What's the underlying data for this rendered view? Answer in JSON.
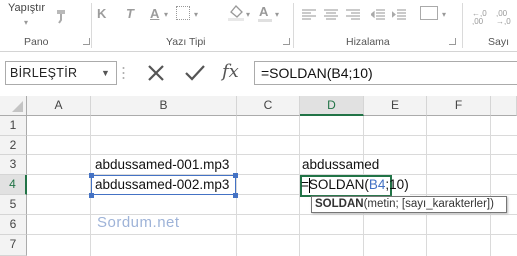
{
  "ribbon": {
    "paste_label": "Yapıştır",
    "groups": [
      "Pano",
      "Yazı Tipi",
      "Hizalama",
      "Sayı"
    ],
    "font_buttons": [
      "K",
      "T",
      "A"
    ]
  },
  "formula_bar": {
    "name_box": "BİRLEŞTİR",
    "fx_label": "fx",
    "formula": "=SOLDAN(B4;10)"
  },
  "grid": {
    "columns": [
      "A",
      "B",
      "C",
      "D",
      "E",
      "F"
    ],
    "rows": [
      "1",
      "2",
      "3",
      "4",
      "5",
      "6",
      "7"
    ],
    "cells": {
      "B3": "abdussamed-001.mp3",
      "B4": "abdussamed-002.mp3",
      "D3": "abdussamed",
      "D4_prefix": "=SOLDAN(",
      "D4_ref": "B4",
      "D4_suffix": ";10)"
    }
  },
  "tooltip": {
    "function_name": "SOLDAN",
    "args": "(metin; [sayı_karakterler])"
  },
  "watermark": "Sordum.net",
  "colors": {
    "excel_green": "#217346",
    "ref_blue": "#4472c4"
  }
}
